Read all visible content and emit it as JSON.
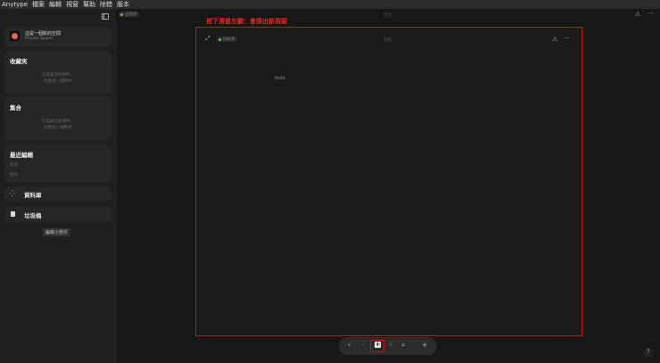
{
  "menu": [
    "Anytype",
    "檔案",
    "編輯",
    "視窗",
    "幫助",
    "除錯",
    "版本"
  ],
  "sidebar": {
    "space": {
      "name": "這是一個新的空間",
      "type": "Private Space"
    },
    "favorites": {
      "title": "收藏夾",
      "empty": [
        "在此處沒有物件，",
        "創建第一個物件"
      ]
    },
    "sets": {
      "title": "集合",
      "empty": [
        "在此處沒有物件，",
        "創建第一個物件"
      ]
    },
    "recent": {
      "title": "最近編輯",
      "items": [
        "空的",
        "空的"
      ]
    },
    "library": "資料庫",
    "bin": "垃圾桶",
    "edit_widgets": "編輯小部件"
  },
  "main": {
    "sync": "已同步",
    "title": "空的"
  },
  "annotation": "按下滑鼠左鍵：會彈出新視窗",
  "popup": {
    "sync": "已同步",
    "title": "空的",
    "content": "Note"
  },
  "dock": {
    "back": "‹",
    "forward": "›",
    "add": "+",
    "graph": "⁘",
    "search": "⌕",
    "settings": "●"
  },
  "help": "?"
}
